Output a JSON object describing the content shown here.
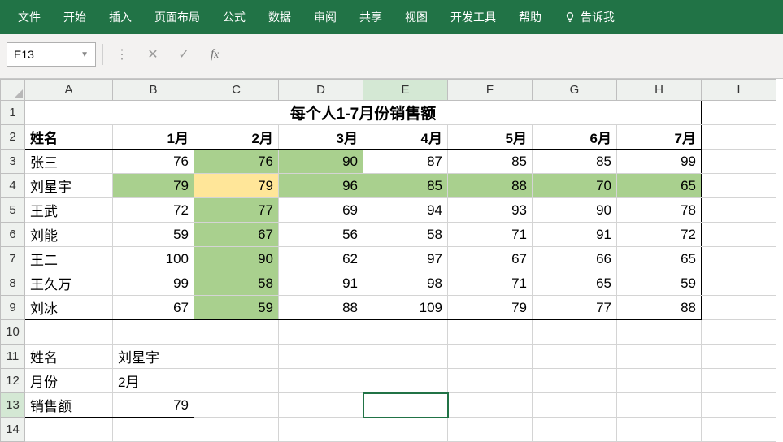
{
  "ribbon": {
    "tabs": [
      "文件",
      "开始",
      "插入",
      "页面布局",
      "公式",
      "数据",
      "审阅",
      "共享",
      "视图",
      "开发工具",
      "帮助"
    ],
    "tellme": "告诉我"
  },
  "formula_bar": {
    "namebox": "E13",
    "formula": ""
  },
  "columns": [
    "A",
    "B",
    "C",
    "D",
    "E",
    "F",
    "G",
    "H",
    "I"
  ],
  "active": {
    "col": "E",
    "row": 13
  },
  "title": "每个人1-7月份销售额",
  "headers": {
    "name": "姓名",
    "months": [
      "1月",
      "2月",
      "3月",
      "4月",
      "5月",
      "6月",
      "7月"
    ]
  },
  "rows": [
    {
      "name": "张三",
      "v": [
        76,
        76,
        90,
        87,
        85,
        85,
        99
      ]
    },
    {
      "name": "刘星宇",
      "v": [
        79,
        79,
        96,
        85,
        88,
        70,
        65
      ]
    },
    {
      "name": "王武",
      "v": [
        72,
        77,
        69,
        94,
        93,
        90,
        78
      ]
    },
    {
      "name": "刘能",
      "v": [
        59,
        67,
        56,
        58,
        71,
        91,
        72
      ]
    },
    {
      "name": "王二",
      "v": [
        100,
        90,
        62,
        97,
        67,
        66,
        65
      ]
    },
    {
      "name": "王久万",
      "v": [
        99,
        58,
        91,
        98,
        71,
        65,
        59
      ]
    },
    {
      "name": "刘冰",
      "v": [
        67,
        59,
        88,
        109,
        79,
        77,
        88
      ]
    }
  ],
  "lookup": {
    "labels": {
      "name": "姓名",
      "month": "月份",
      "sales": "销售额"
    },
    "values": {
      "name": "刘星宇",
      "month": "2月",
      "sales": 79
    }
  },
  "highlight": {
    "green": [
      [
        3,
        1
      ],
      [
        3,
        2
      ],
      [
        4,
        0
      ],
      [
        4,
        2
      ],
      [
        4,
        3
      ],
      [
        4,
        4
      ],
      [
        4,
        5
      ],
      [
        4,
        6
      ],
      [
        5,
        1
      ],
      [
        6,
        1
      ],
      [
        7,
        1
      ],
      [
        8,
        1
      ],
      [
        9,
        1
      ]
    ],
    "yellow": [
      [
        4,
        1
      ]
    ]
  },
  "chart_data": {
    "type": "table",
    "title": "每个人1-7月份销售额",
    "categories": [
      "1月",
      "2月",
      "3月",
      "4月",
      "5月",
      "6月",
      "7月"
    ],
    "series": [
      {
        "name": "张三",
        "values": [
          76,
          76,
          90,
          87,
          85,
          85,
          99
        ]
      },
      {
        "name": "刘星宇",
        "values": [
          79,
          79,
          96,
          85,
          88,
          70,
          65
        ]
      },
      {
        "name": "王武",
        "values": [
          72,
          77,
          69,
          94,
          93,
          90,
          78
        ]
      },
      {
        "name": "刘能",
        "values": [
          59,
          67,
          56,
          58,
          71,
          91,
          72
        ]
      },
      {
        "name": "王二",
        "values": [
          100,
          90,
          62,
          97,
          67,
          66,
          65
        ]
      },
      {
        "name": "王久万",
        "values": [
          99,
          58,
          91,
          98,
          71,
          65,
          59
        ]
      },
      {
        "name": "刘冰",
        "values": [
          67,
          59,
          88,
          109,
          79,
          77,
          88
        ]
      }
    ]
  }
}
